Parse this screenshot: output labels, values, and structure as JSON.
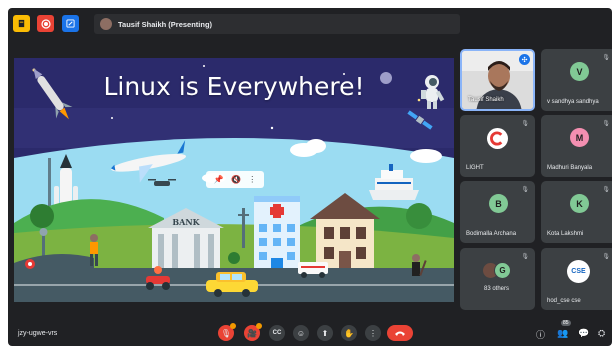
{
  "presenter_label": "Tausif Shaikh (Presenting)",
  "slide": {
    "title": "Linux is Everywhere!",
    "bank_sign": "BANK"
  },
  "tiles": [
    {
      "name": "Tausif Shaikh"
    },
    {
      "name": "v sandhya sandhya",
      "initial": "V",
      "color": "#81c995"
    },
    {
      "name": "LIGHT"
    },
    {
      "name": "Madhuri Banyala",
      "initial": "M",
      "color": "#f48fb1"
    },
    {
      "name": "Bodimalla Archana",
      "initial": "B",
      "color": "#81c995"
    },
    {
      "name": "Kota Lakshmi",
      "initial": "K",
      "color": "#81c995"
    },
    {
      "name": "83 others",
      "initial": "G",
      "color": "#81c995"
    },
    {
      "name": "hod_cse cse",
      "logo_text": "CSE"
    }
  ],
  "meeting_code": "jzy-ugwe-vrs",
  "others_count_badge": "85",
  "colors": {
    "meet_bg": "#202124",
    "tile_bg": "#3c4043",
    "end_call": "#ea4335",
    "active_border": "#8ab4f8"
  },
  "icons": {
    "top_left": [
      "file-icon",
      "record-icon",
      "edit-icon"
    ],
    "bottom": [
      "mic-off-icon",
      "camera-off-icon",
      "captions-icon",
      "emoji-icon",
      "present-icon",
      "raise-hand-icon",
      "more-icon",
      "end-call-icon"
    ],
    "bottom_right": [
      "info-icon",
      "people-icon",
      "chat-icon",
      "activities-icon"
    ]
  }
}
